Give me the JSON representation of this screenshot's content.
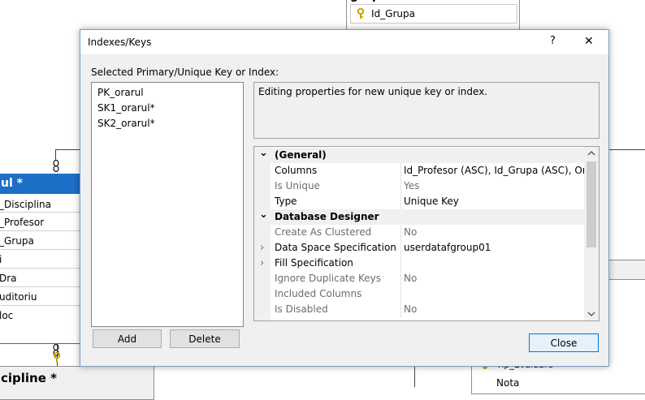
{
  "background": {
    "grupa_title": "grupe",
    "grupa_key_field": "Id_Grupa",
    "orarul_title": "ul *",
    "orarul_fields": [
      "_Disciplina",
      "_Profesor",
      "_Grupa",
      "i",
      "Dra",
      "uditoriu",
      "loc"
    ],
    "discipline_title": "cipline *",
    "evaluare_fields": [
      "Tip_Evaluare",
      "Nota"
    ]
  },
  "dialog": {
    "title": "Indexes/Keys",
    "help_label": "?",
    "close_glyph": "✕",
    "list_label": "Selected Primary/Unique Key or Index:",
    "keys": [
      "PK_orarul",
      "SK1_orarul*",
      "SK2_orarul*"
    ],
    "description": "Editing properties for new unique key or index.",
    "add_label": "Add",
    "delete_label": "Delete",
    "close_label": "Close"
  },
  "properties": [
    {
      "kind": "category",
      "name": "(General)",
      "expander": "⌄"
    },
    {
      "kind": "prop",
      "name": "Columns",
      "value": "Id_Profesor (ASC), Id_Grupa (ASC), Ora (ASC)",
      "disabled": false,
      "expander": ""
    },
    {
      "kind": "prop",
      "name": "Is Unique",
      "value": "Yes",
      "disabled": true,
      "expander": ""
    },
    {
      "kind": "prop",
      "name": "Type",
      "value": "Unique Key",
      "disabled": false,
      "expander": ""
    },
    {
      "kind": "category",
      "name": "Database Designer",
      "expander": "⌄"
    },
    {
      "kind": "prop",
      "name": "Create As Clustered",
      "value": "No",
      "disabled": true,
      "expander": ""
    },
    {
      "kind": "prop",
      "name": "Data Space Specification",
      "value": "userdatafgroup01",
      "disabled": false,
      "expander": "›"
    },
    {
      "kind": "prop",
      "name": "Fill Specification",
      "value": "",
      "disabled": false,
      "expander": "›"
    },
    {
      "kind": "prop",
      "name": "Ignore Duplicate Keys",
      "value": "No",
      "disabled": true,
      "expander": ""
    },
    {
      "kind": "prop",
      "name": "Included Columns",
      "value": "",
      "disabled": true,
      "expander": ""
    },
    {
      "kind": "prop",
      "name": "Is Disabled",
      "value": "No",
      "disabled": true,
      "expander": ""
    }
  ],
  "colors": {
    "table_header_blue": "#1e6fc7",
    "selection_border": "#0078d7",
    "key_icon": "#d9b300"
  }
}
